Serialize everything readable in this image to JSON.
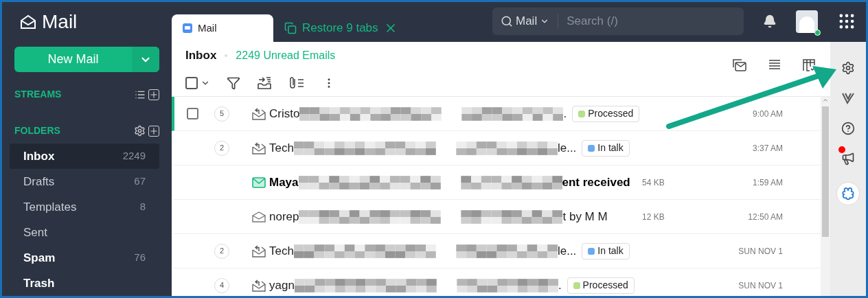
{
  "app": {
    "title": "Mail"
  },
  "new_mail": {
    "label": "New Mail"
  },
  "sections": [
    {
      "title": "STREAMS",
      "kind": "streams"
    },
    {
      "title": "FOLDERS",
      "kind": "folders"
    }
  ],
  "folders": [
    {
      "name": "Inbox",
      "count": "2249",
      "selected": true,
      "unread": true
    },
    {
      "name": "Drafts",
      "count": "67",
      "selected": false,
      "unread": false
    },
    {
      "name": "Templates",
      "count": "8",
      "selected": false,
      "unread": false
    },
    {
      "name": "Sent",
      "selected": false,
      "unread": false
    },
    {
      "name": "Spam",
      "count": "76",
      "selected": false,
      "unread": true
    },
    {
      "name": "Trash",
      "selected": false,
      "unread": true
    }
  ],
  "tabs": [
    {
      "label": "Mail",
      "kind": "tab",
      "selected": true
    },
    {
      "label": "Restore 9 tabs",
      "kind": "restore",
      "selected": false
    }
  ],
  "search": {
    "scope": "Mail",
    "placeholder": "Search (/)"
  },
  "inbox": {
    "title": "Inbox",
    "unread": "2249 Unread Emails",
    "select_all": {
      "checked": false
    }
  },
  "messages": [
    {
      "count": "5",
      "kind": "reply",
      "unread": false,
      "selected": true,
      "sender": "Cristo",
      "subject": ".",
      "tag": {
        "label": "Processed",
        "color": "#b5e08a"
      },
      "time": "9:00 AM"
    },
    {
      "count": "2",
      "kind": "reply",
      "unread": false,
      "selected": false,
      "sender": "Tech",
      "subject": "le...",
      "tag": {
        "label": "In talk",
        "color": "#6aaaf0"
      },
      "time": "3:37 AM"
    },
    {
      "kind": "new",
      "unread": true,
      "selected": false,
      "sender": "Maya",
      "subject": "ent received",
      "size": "54 KB",
      "time": "1:59 AM"
    },
    {
      "kind": "read",
      "unread": false,
      "selected": false,
      "sender": "norep",
      "subject": "t by M M",
      "size": "12 KB",
      "time": "12:50 AM"
    },
    {
      "count": "2",
      "kind": "reply",
      "unread": false,
      "selected": false,
      "sender": "Tech",
      "subject": "le...",
      "tag": {
        "label": "In talk",
        "color": "#6aaaf0"
      },
      "time": "SUN NOV 1"
    },
    {
      "count": "4",
      "kind": "reply",
      "unread": false,
      "selected": false,
      "sender": "yagn",
      "subject": ".",
      "tag": {
        "label": "Processed",
        "color": "#b5e08a"
      },
      "time": "SUN NOV 1"
    }
  ],
  "rail": [
    {
      "kind": "settings"
    },
    {
      "kind": "vivaldi"
    },
    {
      "kind": "help"
    },
    {
      "kind": "feedback",
      "badge": true
    },
    {
      "kind": "plugin"
    }
  ]
}
